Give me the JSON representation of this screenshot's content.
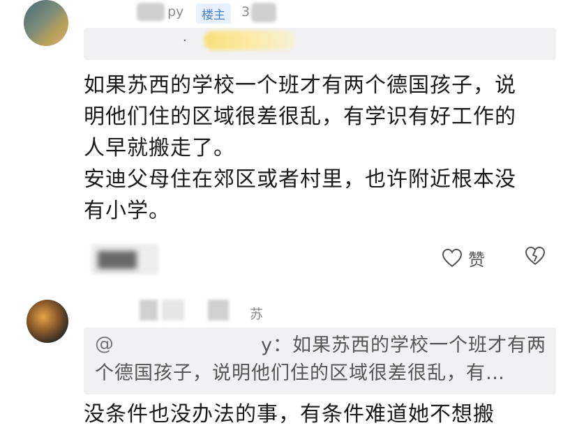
{
  "comment1": {
    "author_suffix": "py",
    "owner_badge": "楼主",
    "time_prefix": "3",
    "banner_dot": "·",
    "text_lines": [
      "如果苏西的学校一个班才有两个德国孩子，说",
      "明他们住的区域很差很乱，有学识有好工作的",
      "人早就搬走了。",
      "安迪父母住在郊区或者村里，也许附近根本没",
      "有小学。"
    ],
    "like_label": "赞",
    "colors": {
      "badge_bg": "#e7f0fd",
      "badge_text": "#4a7fd1"
    }
  },
  "comment2": {
    "location": "苏",
    "quote_at": "@",
    "quote_mid": "y：",
    "quote_line1": "如果苏西的学校一个班才有两",
    "quote_line2": "个德国孩子，说明他们住的区域很差很乱，有…",
    "text": "没条件也没办法的事，有条件难道她不想搬"
  },
  "icons": [
    "heart-outline-icon",
    "broken-heart-icon"
  ]
}
